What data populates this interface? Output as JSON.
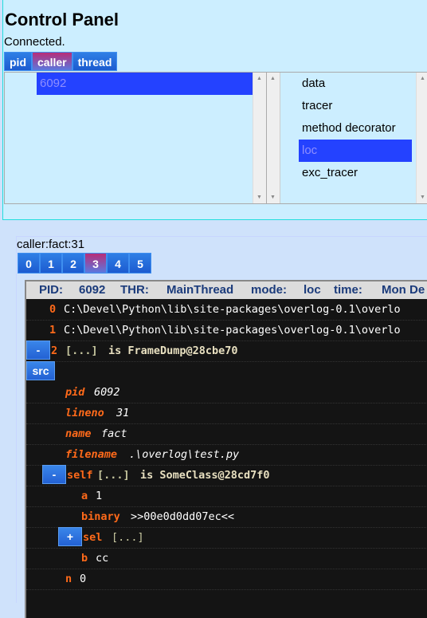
{
  "control_panel": {
    "title": "Control Panel",
    "status": "Connected.",
    "tabs": [
      {
        "label": "pid",
        "active": false
      },
      {
        "label": "caller",
        "active": true
      },
      {
        "label": "thread",
        "active": false
      }
    ],
    "left_list": {
      "items": [
        {
          "label": "6092",
          "selected": true
        }
      ]
    },
    "right_list": {
      "items": [
        {
          "label": "data",
          "selected": false
        },
        {
          "label": "tracer",
          "selected": false
        },
        {
          "label": "method decorator",
          "selected": false
        },
        {
          "label": "loc",
          "selected": true
        },
        {
          "label": "exc_tracer",
          "selected": false
        }
      ]
    }
  },
  "detail": {
    "caller_label": "caller:fact:31",
    "frame_tabs": [
      {
        "label": "0",
        "active": false
      },
      {
        "label": "1",
        "active": false
      },
      {
        "label": "2",
        "active": false
      },
      {
        "label": "3",
        "active": true
      },
      {
        "label": "4",
        "active": false
      },
      {
        "label": "5",
        "active": false
      }
    ],
    "header": {
      "pid_label": "PID:",
      "pid_value": "6092",
      "thr_label": "THR:",
      "thr_value": "MainThread",
      "mode_label": "mode:",
      "mode_value": "loc",
      "time_label": "time:",
      "time_value": "Mon De"
    },
    "tree": {
      "frame0": {
        "index": "0",
        "path": "C:\\Devel\\Python\\lib\\site-packages\\overlog-0.1\\overlo"
      },
      "frame1": {
        "index": "1",
        "path": "C:\\Devel\\Python\\lib\\site-packages\\overlog-0.1\\overlo"
      },
      "frame2": {
        "index": "2",
        "collapse_label": "-",
        "bracket": "[...]",
        "desc": "is FrameDump@28cbe70"
      },
      "src_button": "src",
      "pid": {
        "key": "pid",
        "value": "6092"
      },
      "lineno": {
        "key": "lineno",
        "value": "31"
      },
      "name": {
        "key": "name",
        "value": "fact"
      },
      "filename": {
        "key": "filename",
        "value": ".\\overlog\\test.py"
      },
      "self": {
        "collapse_label": "-",
        "key": "self",
        "bracket": "[...]",
        "desc": "is SomeClass@28cd7f0"
      },
      "a": {
        "key": "a",
        "value": "1"
      },
      "binary": {
        "key": "binary",
        "value": ">>00e0d0dd07ec<<"
      },
      "sel": {
        "expand_label": "+",
        "key": "sel",
        "bracket": "[...]"
      },
      "b": {
        "key": "b",
        "value": "cc"
      },
      "n": {
        "key": "n",
        "value": "0"
      }
    }
  },
  "colors": {
    "accent": "#2361d4",
    "active_tab": "#b82d78",
    "selection": "#2442ff",
    "key_orange": "#ff6a1a",
    "tree_bg": "#141414"
  }
}
